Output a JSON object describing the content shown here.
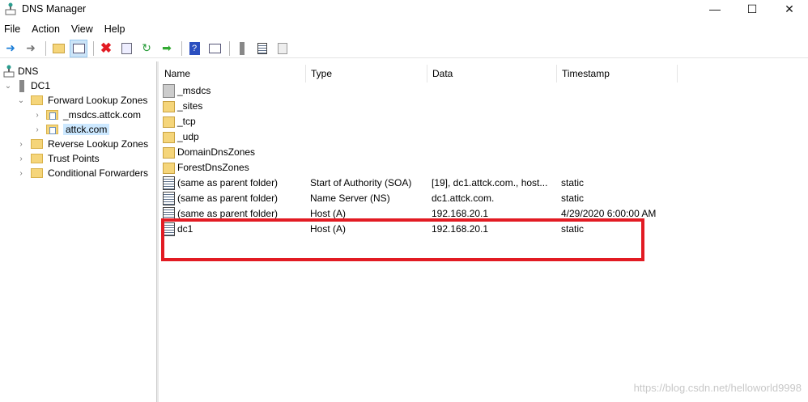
{
  "window": {
    "title": "DNS Manager",
    "controls": [
      "minimize",
      "maximize",
      "close"
    ]
  },
  "menu": [
    "File",
    "Action",
    "View",
    "Help"
  ],
  "toolbar": [
    "back",
    "forward",
    "up-folder",
    "show-hide-console-tree",
    "delete",
    "properties",
    "refresh",
    "export-list",
    "help",
    "show-action-pane",
    "server",
    "list",
    "copy"
  ],
  "tree": {
    "root": "DNS",
    "server": "DC1",
    "forward": "Forward Lookup Zones",
    "zones": [
      "_msdcs.attck.com",
      "attck.com"
    ],
    "others": [
      "Reverse Lookup Zones",
      "Trust Points",
      "Conditional Forwarders"
    ]
  },
  "list": {
    "columns": [
      "Name",
      "Type",
      "Data",
      "Timestamp"
    ],
    "rows": [
      {
        "icon": "zone",
        "name": "_msdcs",
        "type": "",
        "data": "",
        "ts": ""
      },
      {
        "icon": "folder",
        "name": "_sites",
        "type": "",
        "data": "",
        "ts": ""
      },
      {
        "icon": "folder",
        "name": "_tcp",
        "type": "",
        "data": "",
        "ts": ""
      },
      {
        "icon": "folder",
        "name": "_udp",
        "type": "",
        "data": "",
        "ts": ""
      },
      {
        "icon": "folder",
        "name": "DomainDnsZones",
        "type": "",
        "data": "",
        "ts": ""
      },
      {
        "icon": "folder",
        "name": "ForestDnsZones",
        "type": "",
        "data": "",
        "ts": ""
      },
      {
        "icon": "record",
        "name": "(same as parent folder)",
        "type": "Start of Authority (SOA)",
        "data": "[19], dc1.attck.com., host...",
        "ts": "static"
      },
      {
        "icon": "record",
        "name": "(same as parent folder)",
        "type": "Name Server (NS)",
        "data": "dc1.attck.com.",
        "ts": "static"
      },
      {
        "icon": "record",
        "name": "(same as parent folder)",
        "type": "Host (A)",
        "data": "192.168.20.1",
        "ts": "4/29/2020 6:00:00 AM"
      },
      {
        "icon": "record",
        "name": "dc1",
        "type": "Host (A)",
        "data": "192.168.20.1",
        "ts": "static"
      }
    ]
  },
  "watermark": "https://blog.csdn.net/helloworld9998",
  "colors": {
    "highlight": "#e21b23",
    "selection": "#cce8ff"
  }
}
